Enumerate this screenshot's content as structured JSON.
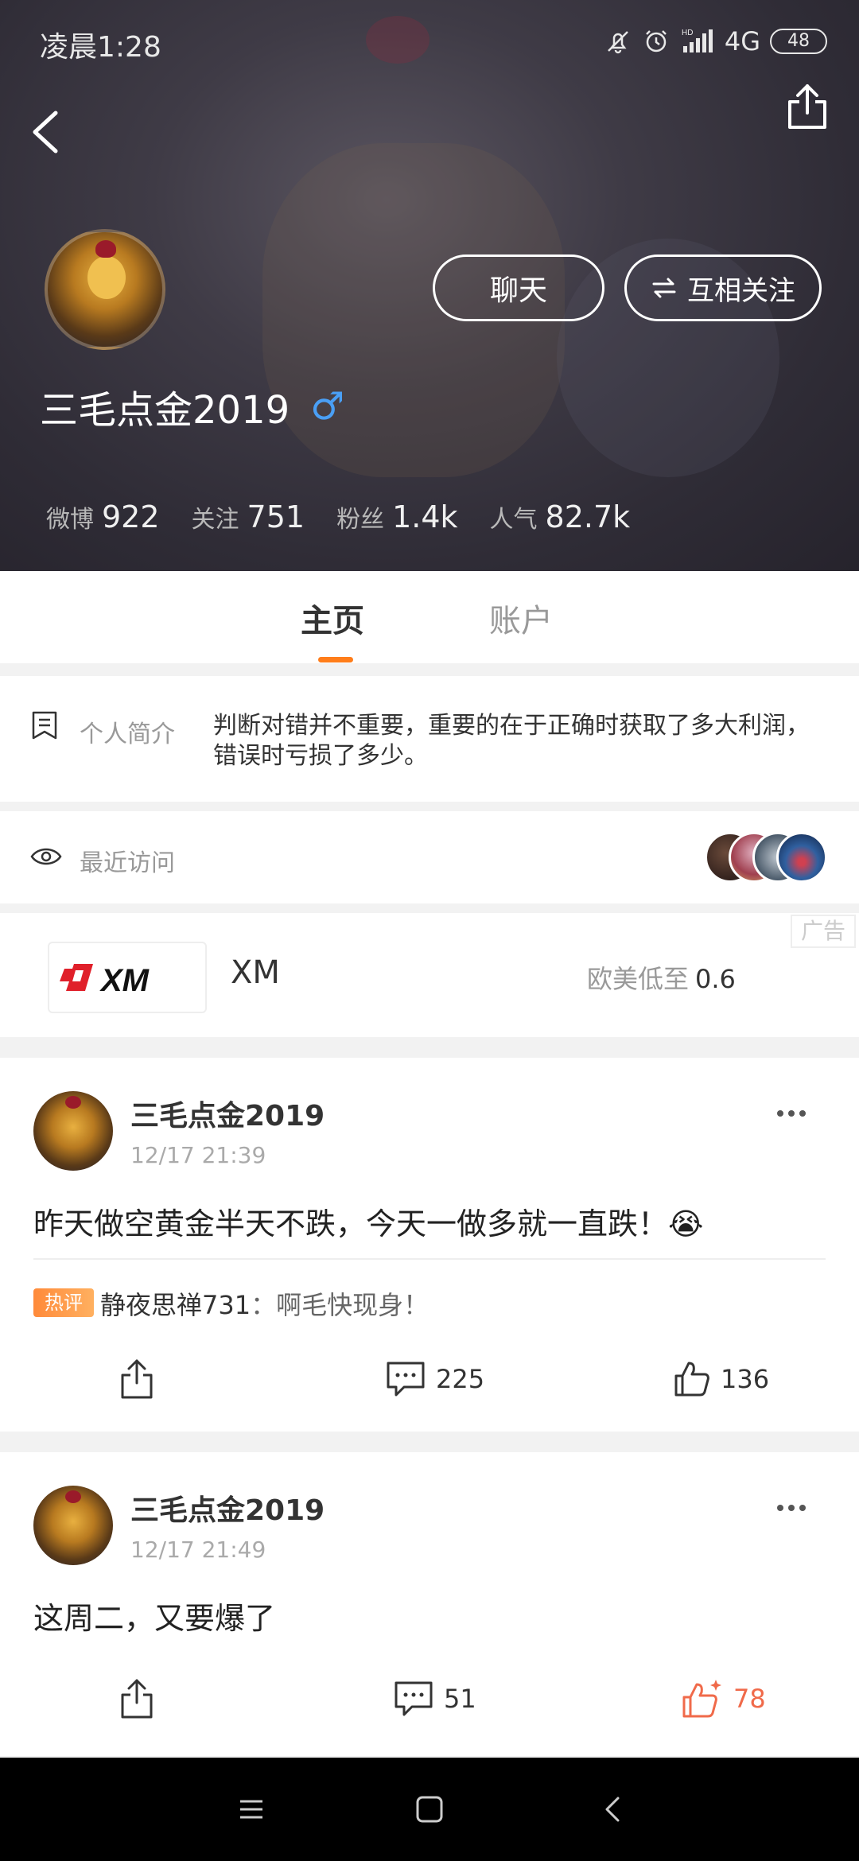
{
  "status_bar": {
    "time": "凌晨1:28",
    "network": "4G",
    "hd_label": "HD",
    "battery": "48"
  },
  "profile": {
    "username": "三毛点金2019",
    "gender_symbol": "♂",
    "chat_label": "聊天",
    "follow_label": "互相关注",
    "stats": [
      {
        "label": "微博",
        "value": "922"
      },
      {
        "label": "关注",
        "value": "751"
      },
      {
        "label": "粉丝",
        "value": "1.4k"
      },
      {
        "label": "人气",
        "value": "82.7k"
      }
    ]
  },
  "tabs": {
    "home": "主页",
    "account": "账户"
  },
  "intro": {
    "label": "个人简介",
    "text": "判断对错并不重要，重要的在于正确时获取了多大利润，错误时亏损了多少。"
  },
  "visits": {
    "label": "最近访问"
  },
  "ad": {
    "tag": "广告",
    "logo_text": "XM",
    "name": "XM",
    "spread_label": "欧美低至",
    "spread_value": "0.6"
  },
  "posts": [
    {
      "author": "三毛点金2019",
      "time": "12/17 21:39",
      "text": "昨天做空黄金半天不跌，今天一做多就一直跌！😭",
      "hot_badge": "热评",
      "hot_user": "静夜思禅731",
      "hot_text": "：啊毛快现身！",
      "comments": "225",
      "likes": "136"
    },
    {
      "author": "三毛点金2019",
      "time": "12/17 21:49",
      "text": "这周二，又要爆了",
      "comments": "51",
      "likes": "78"
    }
  ],
  "colors": {
    "accent": "#ff7d1a",
    "liked": "#f06a4a",
    "gender": "#4a9ff5",
    "ad_logo_red": "#e0202a"
  }
}
